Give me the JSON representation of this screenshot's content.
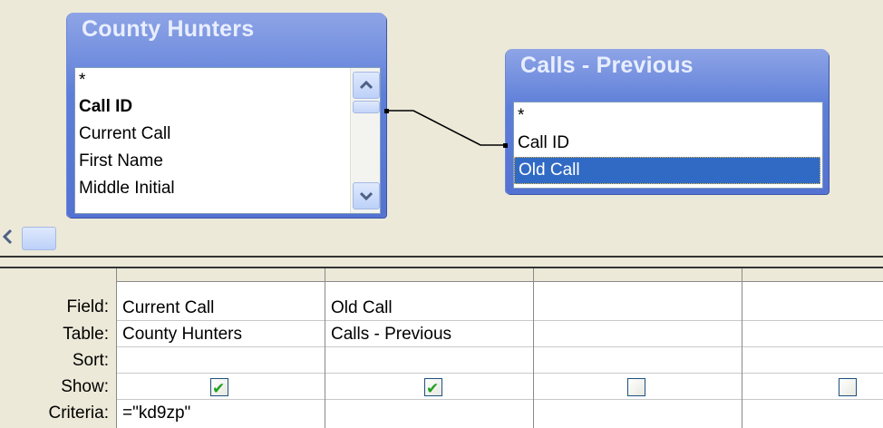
{
  "tables": [
    {
      "title": "County Hunters",
      "fields": [
        "*",
        "Call ID",
        "Current Call",
        "First Name",
        "Middle Initial"
      ],
      "bold_field_index": 1
    },
    {
      "title": "Calls - Previous",
      "fields": [
        "*",
        "Call ID",
        "Old Call"
      ],
      "selected_field_index": 2
    }
  ],
  "grid": {
    "row_labels": [
      "Field:",
      "Table:",
      "Sort:",
      "Show:",
      "Criteria:"
    ],
    "columns": [
      {
        "field": "Current Call",
        "table": "County Hunters",
        "sort": "",
        "show": true,
        "criteria": "=\"kd9zp\""
      },
      {
        "field": "Old Call",
        "table": "Calls - Previous",
        "sort": "",
        "show": true,
        "criteria": ""
      },
      {
        "field": "",
        "table": "",
        "sort": "",
        "show": false,
        "criteria": ""
      },
      {
        "field": "",
        "table": "",
        "sort": "",
        "show": false,
        "criteria": ""
      }
    ]
  },
  "icons": {
    "scroll_up": "chevron-up-icon",
    "scroll_down": "chevron-down-icon",
    "scroll_left": "chevron-left-icon"
  },
  "colors": {
    "title_bar": "#5d7ed8",
    "selection": "#316ac5",
    "check": "#21a121"
  }
}
